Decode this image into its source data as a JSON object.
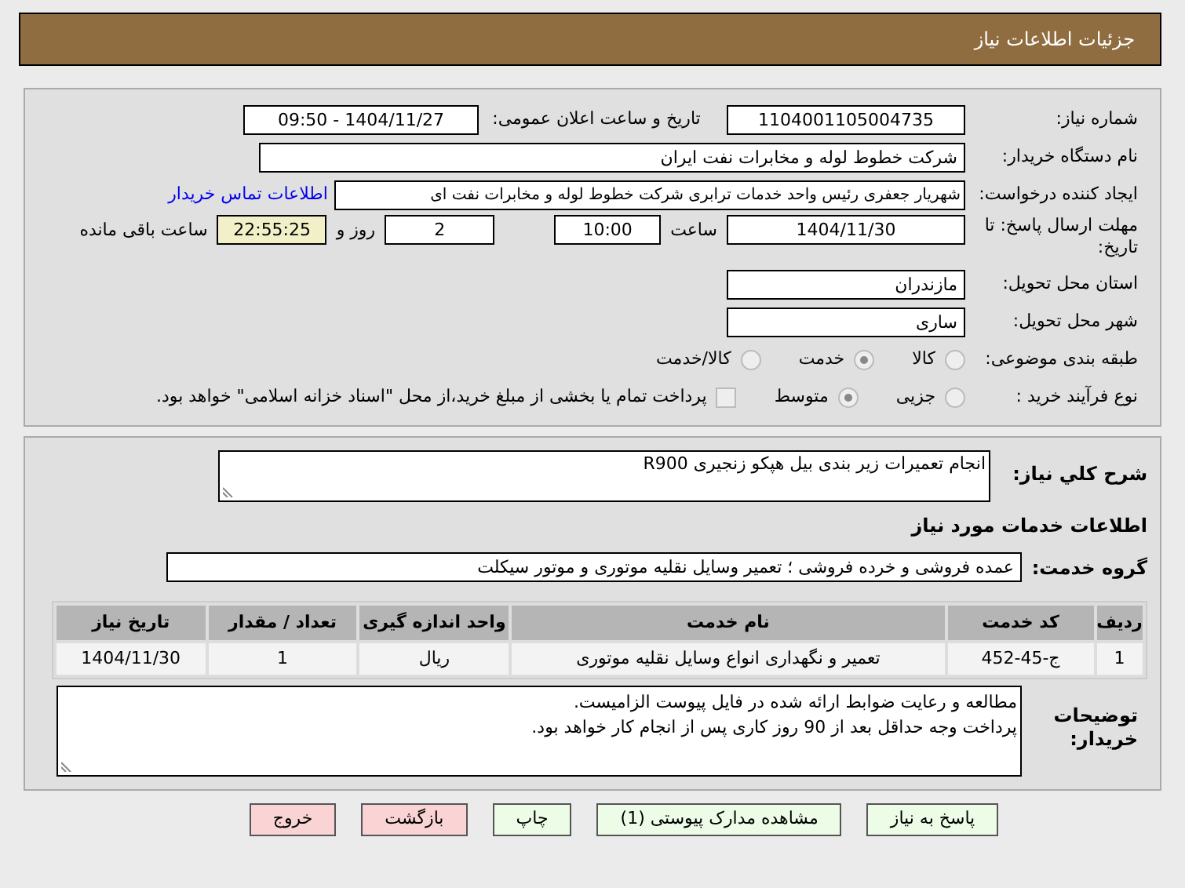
{
  "header": {
    "title": "جزئیات اطلاعات نیاز"
  },
  "details": {
    "need_number": {
      "label": "شماره نیاز:",
      "value": "1104001105004735"
    },
    "announce": {
      "label": "تاریخ و ساعت اعلان عمومی:",
      "value": "1404/11/27 - 09:50"
    },
    "buyer": {
      "label": "نام دستگاه خریدار:",
      "value": "شرکت خطوط لوله و مخابرات نفت ایران"
    },
    "creator": {
      "label": "ایجاد کننده درخواست:",
      "value": "شهریار  جعفری  رئیس واحد خدمات ترابری  شرکت خطوط لوله و مخابرات نفت ای",
      "link": "اطلاعات تماس خریدار"
    },
    "deadline": {
      "label": "مهلت ارسال پاسخ: تا تاریخ:",
      "date": "1404/11/30",
      "time_label": "ساعت",
      "time": "10:00",
      "days": "2",
      "days_label": "روز و",
      "remaining": "22:55:25",
      "remaining_label": "ساعت باقی مانده"
    },
    "province": {
      "label": "استان محل تحویل:",
      "value": "مازندران"
    },
    "city": {
      "label": "شهر محل تحویل:",
      "value": "ساری"
    },
    "category": {
      "label": "طبقه بندی موضوعی:",
      "options": [
        {
          "label": "کالا",
          "selected": false
        },
        {
          "label": "خدمت",
          "selected": true
        },
        {
          "label": "کالا/خدمت",
          "selected": false
        }
      ]
    },
    "process": {
      "label": "نوع فرآیند خرید :",
      "options": [
        {
          "label": "جزیی",
          "selected": false
        },
        {
          "label": "متوسط",
          "selected": true
        }
      ],
      "payment": {
        "label": "پرداخت تمام یا بخشی از مبلغ خرید،از محل \"اسناد خزانه اسلامی\" خواهد بود.",
        "checked": false
      }
    }
  },
  "description": {
    "label": "شرح کلي نياز:",
    "value": "انجام تعمیرات زیر بندی بیل هپکو زنجیری R900"
  },
  "services_heading": "اطلاعات خدمات مورد نیاز",
  "service_group": {
    "label": "گروه خدمت:",
    "value": "عمده فروشی و خرده فروشی ؛ تعمیر وسایل نقلیه موتوری و موتور سیکلت"
  },
  "table": {
    "columns": [
      "ردیف",
      "کد خدمت",
      "نام خدمت",
      "واحد اندازه گیری",
      "تعداد / مقدار",
      "تاریخ نیاز"
    ],
    "rows": [
      [
        "1",
        "ج-45-452",
        "تعمیر و نگهداری انواع وسایل نقلیه موتوری",
        "ریال",
        "1",
        "1404/11/30"
      ]
    ]
  },
  "buyer_notes": {
    "label": "توضیحات خریدار:",
    "lines": [
      "مطالعه و رعایت ضوابط ارائه شده در فایل پیوست الزامیست.",
      "پرداخت وجه حداقل بعد از 90 روز کاری پس از انجام کار خواهد بود."
    ]
  },
  "buttons": [
    {
      "label": "پاسخ به نیاز",
      "kind": "action"
    },
    {
      "label": "مشاهده مدارک پیوستی (1)",
      "kind": "action"
    },
    {
      "label": "چاپ",
      "kind": "action"
    },
    {
      "label": "بازگشت",
      "kind": "exit"
    },
    {
      "label": "خروج",
      "kind": "exit"
    }
  ]
}
